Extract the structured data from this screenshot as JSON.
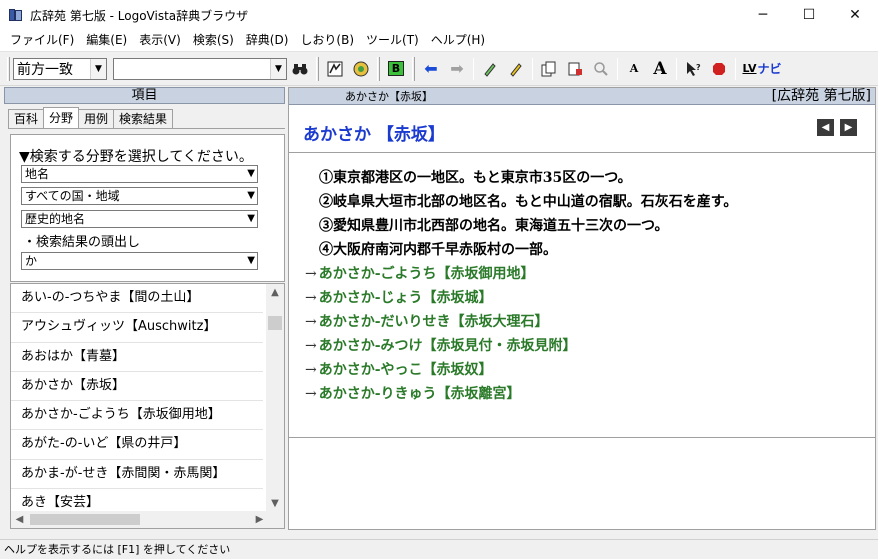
{
  "window": {
    "title": "広辞苑 第七版 - LogoVista辞典ブラウザ",
    "minimize": "─",
    "maximize": "☐",
    "close": "✕"
  },
  "menu": [
    "ファイル(F)",
    "編集(E)",
    "表示(V)",
    "検索(S)",
    "辞典(D)",
    "しおり(B)",
    "ツール(T)",
    "ヘルプ(H)"
  ],
  "toolbar": {
    "match_mode": "前方一致",
    "search_value": "",
    "nav_label": "ナビ",
    "lv_label": "LV",
    "small_a": "A",
    "large_a": "A",
    "b_label": "B"
  },
  "left": {
    "header": "項目",
    "tabs": [
      "百科",
      "分野",
      "用例",
      "検索結果"
    ],
    "active_tab": "分野",
    "filter_title": "▼検索する分野を選択してください。",
    "selects": [
      "地名",
      "すべての国・地域",
      "歴史的地名"
    ],
    "result_head_label": "・検索結果の頭出し",
    "result_head_value": "か",
    "words": [
      "あい-の-つちやま【間の土山】",
      "アウシュヴィッツ【Auschwitz】",
      "あおはか【青墓】",
      "あかさか【赤坂】",
      "あかさか-ごようち【赤坂御用地】",
      "あがた-の-いど【県の井戸】",
      "あかま-が-せき【赤間関・赤馬関】",
      "あき【安芸】"
    ]
  },
  "right": {
    "header_keyword": "あかさか【赤坂】",
    "header_dict": "[広辞苑 第七版]",
    "headword": "あかさか 【赤坂】",
    "definitions": [
      "①東京都港区の一地区。もと東京市35区の一つ。",
      "②岐阜県大垣市北部の地区名。もと中山道の宿駅。石灰石を産す。",
      "③愛知県豊川市北西部の地名。東海道五十三次の一つ。",
      "④大阪府南河内郡千早赤阪村の一部。"
    ],
    "references": [
      "あかさか‐ごようち【赤坂御用地】",
      "あかさか‐じょう【赤坂城】",
      "あかさか‐だいりせき【赤坂大理石】",
      "あかさか‐みつけ【赤坂見付・赤坂見附】",
      "あかさか‐やっこ【赤坂奴】",
      "あかさか‐りきゅう【赤坂離宮】"
    ],
    "ref_arrow": "→",
    "prev": "◀",
    "next": "▶"
  },
  "status": "ヘルプを表示するには [F1] を押してください",
  "colors": {
    "headword": "#1a3ad0",
    "reference": "#2a7a2a"
  }
}
